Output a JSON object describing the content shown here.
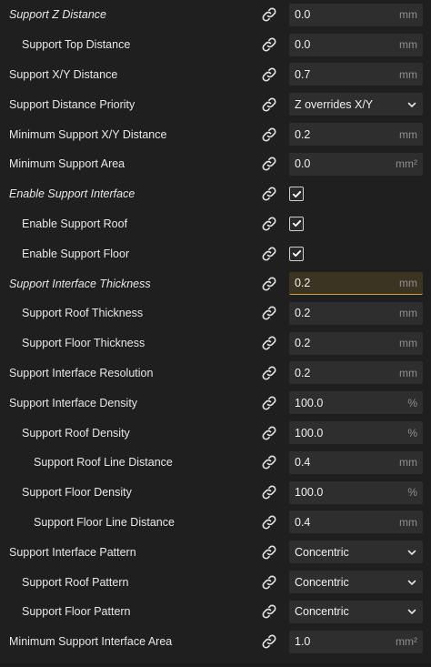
{
  "rows": [
    {
      "label": "Support Z Distance",
      "italic": true,
      "indent": 0,
      "type": "number",
      "value": "0.0",
      "unit": "mm"
    },
    {
      "label": "Support Top Distance",
      "italic": false,
      "indent": 1,
      "type": "number",
      "value": "0.0",
      "unit": "mm"
    },
    {
      "label": "Support X/Y Distance",
      "italic": false,
      "indent": 0,
      "type": "number",
      "value": "0.7",
      "unit": "mm"
    },
    {
      "label": "Support Distance Priority",
      "italic": false,
      "indent": 0,
      "type": "select",
      "value": "Z overrides X/Y"
    },
    {
      "label": "Minimum Support X/Y Distance",
      "italic": false,
      "indent": 0,
      "type": "number",
      "value": "0.2",
      "unit": "mm"
    },
    {
      "label": "Minimum Support Area",
      "italic": false,
      "indent": 0,
      "type": "number",
      "value": "0.0",
      "unit": "mm²"
    },
    {
      "label": "Enable Support Interface",
      "italic": true,
      "indent": 0,
      "type": "checkbox",
      "checked": true
    },
    {
      "label": "Enable Support Roof",
      "italic": false,
      "indent": 1,
      "type": "checkbox",
      "checked": true
    },
    {
      "label": "Enable Support Floor",
      "italic": false,
      "indent": 1,
      "type": "checkbox",
      "checked": true
    },
    {
      "label": "Support Interface Thickness",
      "italic": true,
      "indent": 0,
      "type": "number",
      "value": "0.2",
      "unit": "mm",
      "highlight": true
    },
    {
      "label": "Support Roof Thickness",
      "italic": false,
      "indent": 1,
      "type": "number",
      "value": "0.2",
      "unit": "mm"
    },
    {
      "label": "Support Floor Thickness",
      "italic": false,
      "indent": 1,
      "type": "number",
      "value": "0.2",
      "unit": "mm"
    },
    {
      "label": "Support Interface Resolution",
      "italic": false,
      "indent": 0,
      "type": "number",
      "value": "0.2",
      "unit": "mm"
    },
    {
      "label": "Support Interface Density",
      "italic": false,
      "indent": 0,
      "type": "number",
      "value": "100.0",
      "unit": "%"
    },
    {
      "label": "Support Roof Density",
      "italic": false,
      "indent": 1,
      "type": "number",
      "value": "100.0",
      "unit": "%"
    },
    {
      "label": "Support Roof Line Distance",
      "italic": false,
      "indent": 2,
      "type": "number",
      "value": "0.4",
      "unit": "mm"
    },
    {
      "label": "Support Floor Density",
      "italic": false,
      "indent": 1,
      "type": "number",
      "value": "100.0",
      "unit": "%"
    },
    {
      "label": "Support Floor Line Distance",
      "italic": false,
      "indent": 2,
      "type": "number",
      "value": "0.4",
      "unit": "mm"
    },
    {
      "label": "Support Interface Pattern",
      "italic": false,
      "indent": 0,
      "type": "select",
      "value": "Concentric"
    },
    {
      "label": "Support Roof Pattern",
      "italic": false,
      "indent": 1,
      "type": "select",
      "value": "Concentric"
    },
    {
      "label": "Support Floor Pattern",
      "italic": false,
      "indent": 1,
      "type": "select",
      "value": "Concentric"
    },
    {
      "label": "Minimum Support Interface Area",
      "italic": false,
      "indent": 0,
      "type": "number",
      "value": "1.0",
      "unit": "mm²"
    }
  ],
  "icons": {
    "link": "link-icon",
    "check": "checkmark-icon",
    "chevron": "chevron-down-icon"
  },
  "colors": {
    "background": "#1f1f1f",
    "field": "#2e2e2e",
    "highlight_field": "#3b3423",
    "highlight_border": "#c8a23a",
    "unit_text": "#8f8f8f"
  }
}
